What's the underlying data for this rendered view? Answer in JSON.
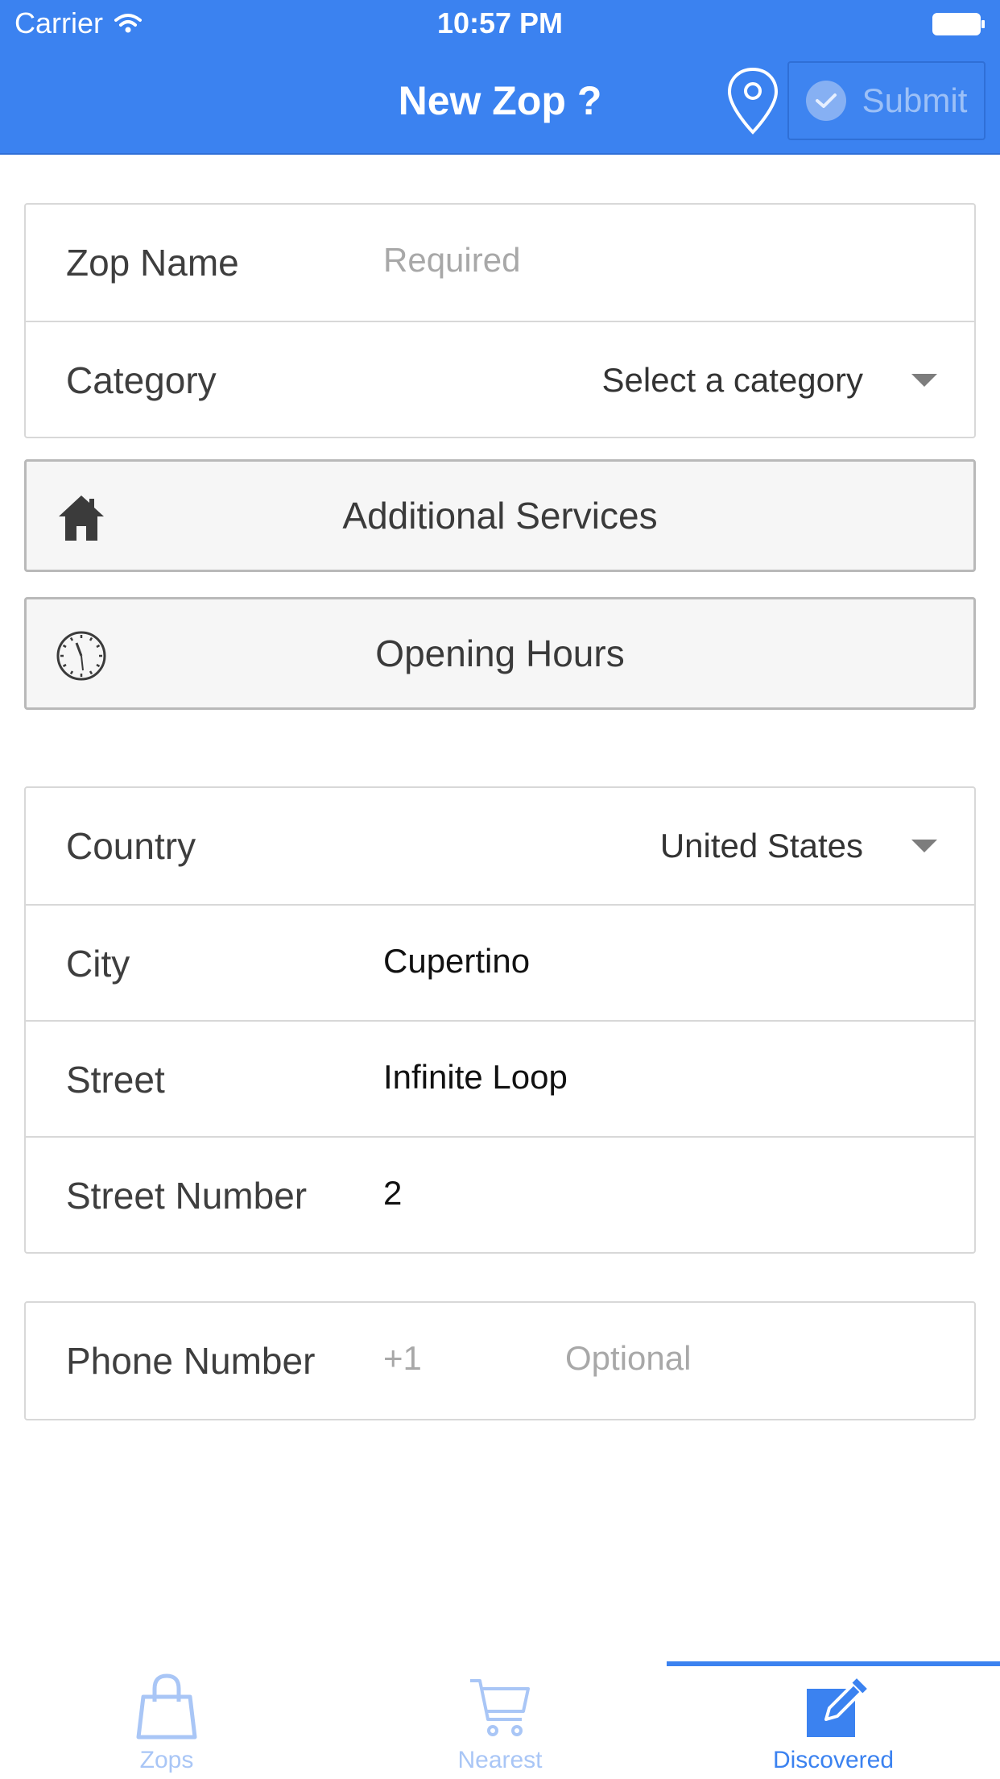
{
  "status_bar": {
    "carrier": "Carrier",
    "time": "10:57 PM"
  },
  "nav": {
    "title": "New Zop ?",
    "submit_label": "Submit"
  },
  "form": {
    "zop_name": {
      "label": "Zop Name",
      "placeholder": "Required"
    },
    "category": {
      "label": "Category",
      "value": "Select a category"
    },
    "additional_services": {
      "label": "Additional Services"
    },
    "opening_hours": {
      "label": "Opening Hours"
    },
    "country": {
      "label": "Country",
      "value": "United States"
    },
    "city": {
      "label": "City",
      "value": "Cupertino"
    },
    "street": {
      "label": "Street",
      "value": "Infinite Loop"
    },
    "street_number": {
      "label": "Street Number",
      "value": "2"
    },
    "phone": {
      "label": "Phone Number",
      "prefix": "+1",
      "placeholder": "Optional"
    }
  },
  "tabs": [
    {
      "label": "Zops",
      "icon": "shopping-bag-icon",
      "active": false
    },
    {
      "label": "Nearest",
      "icon": "cart-icon",
      "active": false
    },
    {
      "label": "Discovered",
      "icon": "edit-icon",
      "active": true
    }
  ],
  "colors": {
    "accent": "#3b82f0",
    "inactive_tab": "#a9c6f6",
    "placeholder": "#a8a8a8"
  }
}
